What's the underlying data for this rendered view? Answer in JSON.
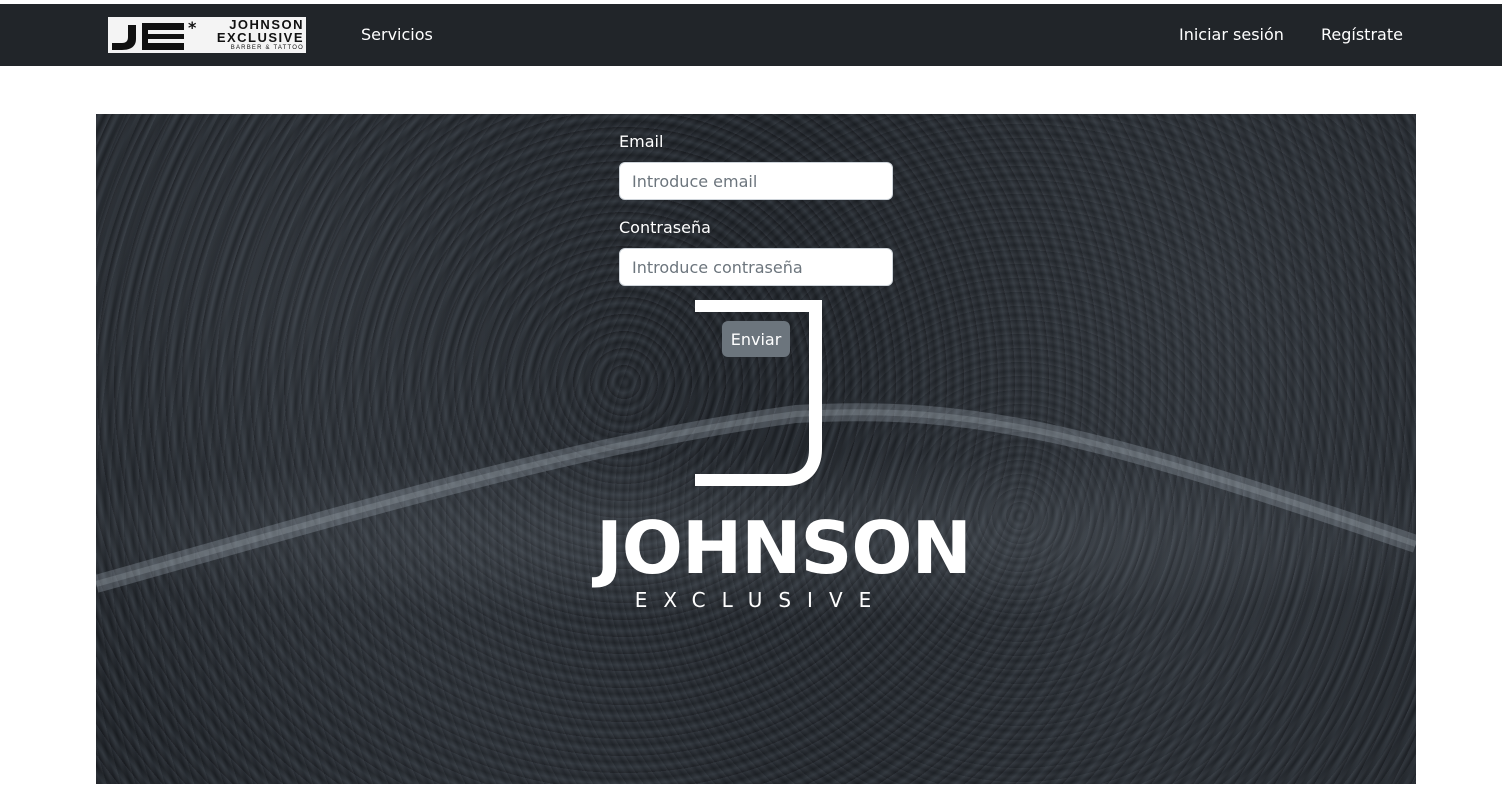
{
  "navbar": {
    "brand": {
      "mark": "JE",
      "star": "*",
      "line1": "JOHNSON",
      "line2": "EXCLUSIVE",
      "line3": "BARBER & TATTOO"
    },
    "services": "Servicios",
    "login": "Iniciar sesión",
    "register": "Regístrate"
  },
  "hero": {
    "logo_title": "JOHNSON",
    "logo_subtitle": "EXCLUSIVE"
  },
  "form": {
    "email_label": "Email",
    "email_placeholder": "Introduce email",
    "password_label": "Contraseña",
    "password_placeholder": "Introduce contraseña",
    "submit": "Enviar"
  },
  "colors": {
    "navbar_bg": "#212529",
    "button_bg": "#6c757d",
    "text_light": "#ffffff"
  }
}
